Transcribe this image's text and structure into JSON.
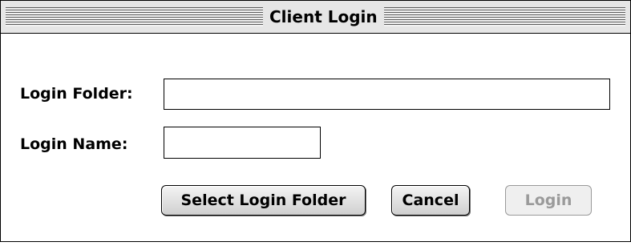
{
  "window": {
    "title": "Client Login"
  },
  "form": {
    "login_folder_label": "Login Folder:",
    "login_folder_value": "",
    "login_name_label": "Login Name:",
    "login_name_value": ""
  },
  "buttons": {
    "select_folder": "Select Login Folder",
    "cancel": "Cancel",
    "login": "Login",
    "login_enabled": false
  }
}
